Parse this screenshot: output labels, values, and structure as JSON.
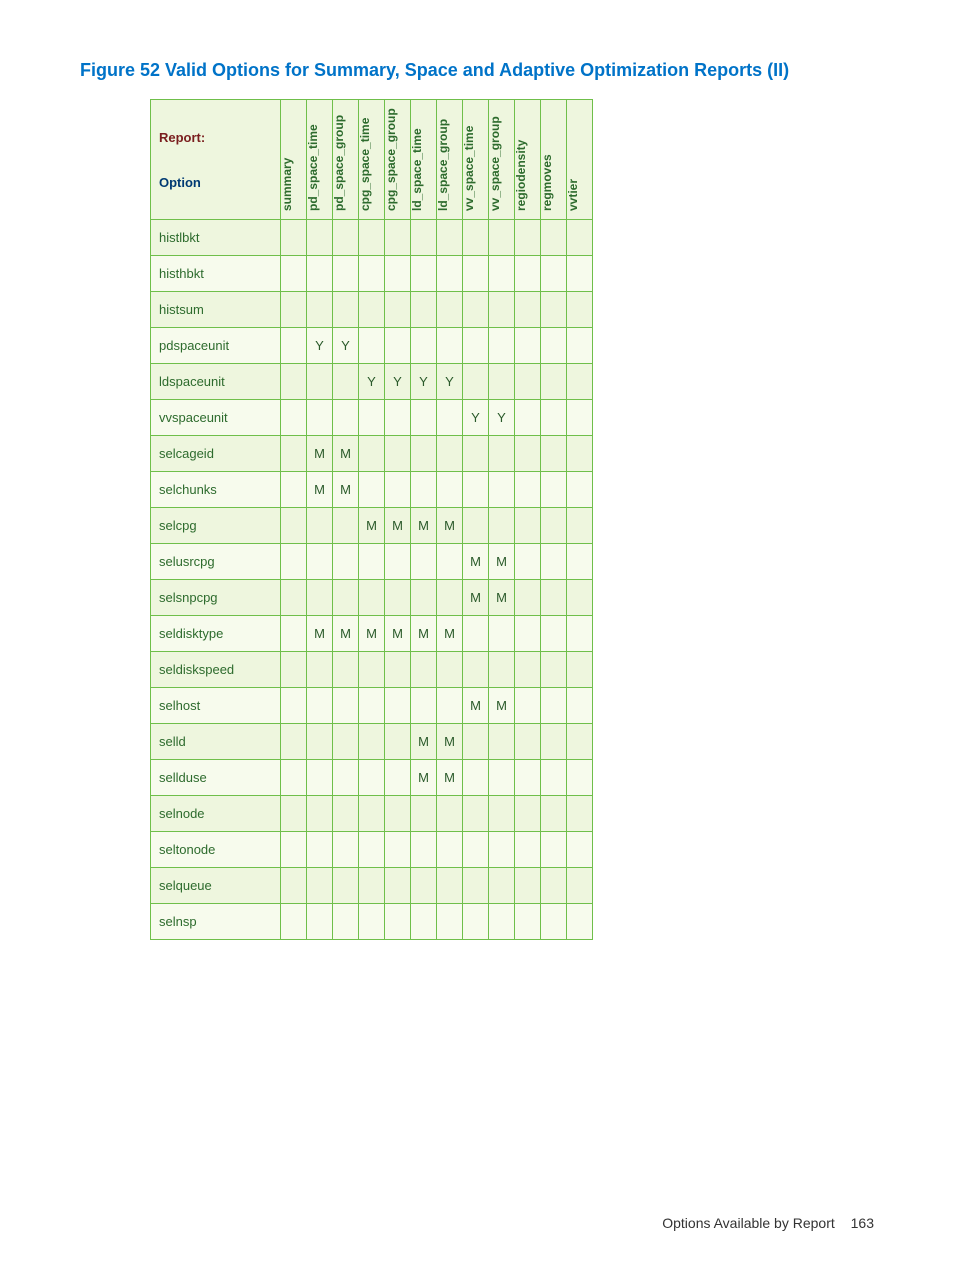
{
  "figure_title": "Figure 52 Valid Options for Summary, Space and Adaptive Optimization Reports (II)",
  "header": {
    "report_label": "Report:",
    "option_label": "Option",
    "columns": [
      "summary",
      "pd_space_time",
      "pd_space_group",
      "cpg_space_time",
      "cpg_space_group",
      "ld_space_time",
      "ld_space_group",
      "vv_space_time",
      "vv_space_group",
      "regiodensity",
      "regmoves",
      "vvtier"
    ]
  },
  "rows": [
    {
      "option": "histlbkt",
      "cells": [
        "",
        "",
        "",
        "",
        "",
        "",
        "",
        "",
        "",
        "",
        "",
        ""
      ]
    },
    {
      "option": "histhbkt",
      "cells": [
        "",
        "",
        "",
        "",
        "",
        "",
        "",
        "",
        "",
        "",
        "",
        ""
      ]
    },
    {
      "option": "histsum",
      "cells": [
        "",
        "",
        "",
        "",
        "",
        "",
        "",
        "",
        "",
        "",
        "",
        ""
      ]
    },
    {
      "option": "pdspaceunit",
      "cells": [
        "",
        "Y",
        "Y",
        "",
        "",
        "",
        "",
        "",
        "",
        "",
        "",
        ""
      ]
    },
    {
      "option": "ldspaceunit",
      "cells": [
        "",
        "",
        "",
        "Y",
        "Y",
        "Y",
        "Y",
        "",
        "",
        "",
        "",
        ""
      ]
    },
    {
      "option": "vvspaceunit",
      "cells": [
        "",
        "",
        "",
        "",
        "",
        "",
        "",
        "Y",
        "Y",
        "",
        "",
        ""
      ]
    },
    {
      "option": "selcageid",
      "cells": [
        "",
        "M",
        "M",
        "",
        "",
        "",
        "",
        "",
        "",
        "",
        "",
        ""
      ]
    },
    {
      "option": "selchunks",
      "cells": [
        "",
        "M",
        "M",
        "",
        "",
        "",
        "",
        "",
        "",
        "",
        "",
        ""
      ]
    },
    {
      "option": "selcpg",
      "cells": [
        "",
        "",
        "",
        "M",
        "M",
        "M",
        "M",
        "",
        "",
        "",
        "",
        ""
      ]
    },
    {
      "option": "selusrcpg",
      "cells": [
        "",
        "",
        "",
        "",
        "",
        "",
        "",
        "M",
        "M",
        "",
        "",
        ""
      ]
    },
    {
      "option": "selsnpcpg",
      "cells": [
        "",
        "",
        "",
        "",
        "",
        "",
        "",
        "M",
        "M",
        "",
        "",
        ""
      ]
    },
    {
      "option": "seldisktype",
      "cells": [
        "",
        "M",
        "M",
        "M",
        "M",
        "M",
        "M",
        "",
        "",
        "",
        "",
        ""
      ]
    },
    {
      "option": "seldiskspeed",
      "cells": [
        "",
        "",
        "",
        "",
        "",
        "",
        "",
        "",
        "",
        "",
        "",
        ""
      ]
    },
    {
      "option": "selhost",
      "cells": [
        "",
        "",
        "",
        "",
        "",
        "",
        "",
        "M",
        "M",
        "",
        "",
        ""
      ]
    },
    {
      "option": "selld",
      "cells": [
        "",
        "",
        "",
        "",
        "",
        "M",
        "M",
        "",
        "",
        "",
        "",
        ""
      ]
    },
    {
      "option": "sellduse",
      "cells": [
        "",
        "",
        "",
        "",
        "",
        "M",
        "M",
        "",
        "",
        "",
        "",
        ""
      ]
    },
    {
      "option": "selnode",
      "cells": [
        "",
        "",
        "",
        "",
        "",
        "",
        "",
        "",
        "",
        "",
        "",
        ""
      ]
    },
    {
      "option": "seltonode",
      "cells": [
        "",
        "",
        "",
        "",
        "",
        "",
        "",
        "",
        "",
        "",
        "",
        ""
      ]
    },
    {
      "option": "selqueue",
      "cells": [
        "",
        "",
        "",
        "",
        "",
        "",
        "",
        "",
        "",
        "",
        "",
        ""
      ]
    },
    {
      "option": "selnsp",
      "cells": [
        "",
        "",
        "",
        "",
        "",
        "",
        "",
        "",
        "",
        "",
        "",
        ""
      ]
    }
  ],
  "footer": {
    "section": "Options Available by Report",
    "page_number": "163"
  }
}
